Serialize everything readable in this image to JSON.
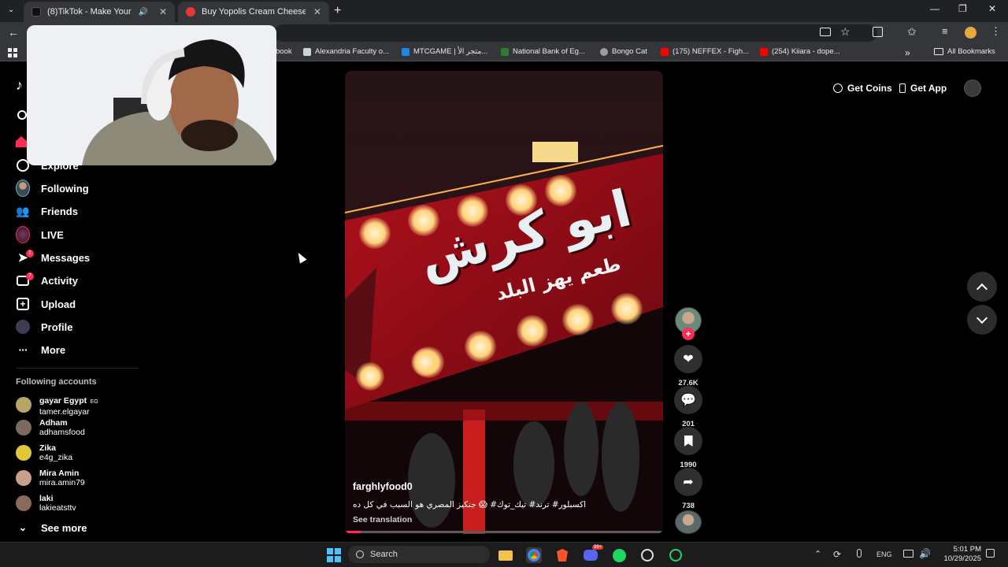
{
  "browser": {
    "tabs": [
      {
        "label": "(8)TikTok - Make Your Day"
      },
      {
        "label": "Buy Yopolis Cream Cheese Plain"
      }
    ],
    "new_tab_symbol": "+",
    "bookmarks": [
      {
        "label": "book"
      },
      {
        "label": "Alexandria Faculty o..."
      },
      {
        "label": "MTCGAME | متجر الأ..."
      },
      {
        "label": "National Bank of Eg..."
      },
      {
        "label": "Bongo Cat"
      },
      {
        "label": "(175) NEFFEX - Figh..."
      },
      {
        "label": "(254) Kiiara - dope..."
      }
    ],
    "all_bookmarks": "All Bookmarks",
    "chevrons": "»"
  },
  "sidebar": {
    "nav": [
      {
        "label": "Explore",
        "icon": "compass-icon"
      },
      {
        "label": "Following",
        "icon": "avatar-icon"
      },
      {
        "label": "Friends",
        "icon": "friends-icon"
      },
      {
        "label": "LIVE",
        "icon": "live-icon"
      },
      {
        "label": "Messages",
        "icon": "messages-icon",
        "badge": "1"
      },
      {
        "label": "Activity",
        "icon": "activity-icon",
        "badge": "7"
      },
      {
        "label": "Upload",
        "icon": "upload-icon"
      },
      {
        "label": "Profile",
        "icon": "profile-icon"
      },
      {
        "label": "More",
        "icon": "more-icon"
      }
    ],
    "following_heading": "Following accounts",
    "accounts": [
      {
        "name": "gayar Egypt",
        "suffix": "EG",
        "username": "tamer.elgayar"
      },
      {
        "name": "Adham",
        "username": "adhamsfood"
      },
      {
        "name": "Zika",
        "username": "e4g_zika"
      },
      {
        "name": "Mira Amin",
        "username": "mira.amin79"
      },
      {
        "name": "laki",
        "username": "lakieatsttv"
      }
    ],
    "see_more": "See more"
  },
  "header": {
    "get_coins": "Get Coins",
    "get_app": "Get App"
  },
  "video": {
    "sign_main": "ابو كرش",
    "sign_sub": "طعم يهز البلد",
    "author": "farghlyfood0",
    "caption": "اكسبلور# ترند# تيك_توك# 😱 جنكيز المصري هو السبب في كل ده",
    "see_translation": "See translation",
    "progress": 0.05
  },
  "actions": {
    "likes": "27.6K",
    "comments": "201",
    "saves": "1990",
    "shares": "738"
  },
  "taskbar": {
    "search_placeholder": "Search",
    "language": "ENG",
    "time": "5:01 PM",
    "date": "10/29/2025",
    "discord_badge": "99+"
  },
  "colors": {
    "accent": "#fe2c55",
    "background": "#000000",
    "browser_frame": "#35363a"
  }
}
